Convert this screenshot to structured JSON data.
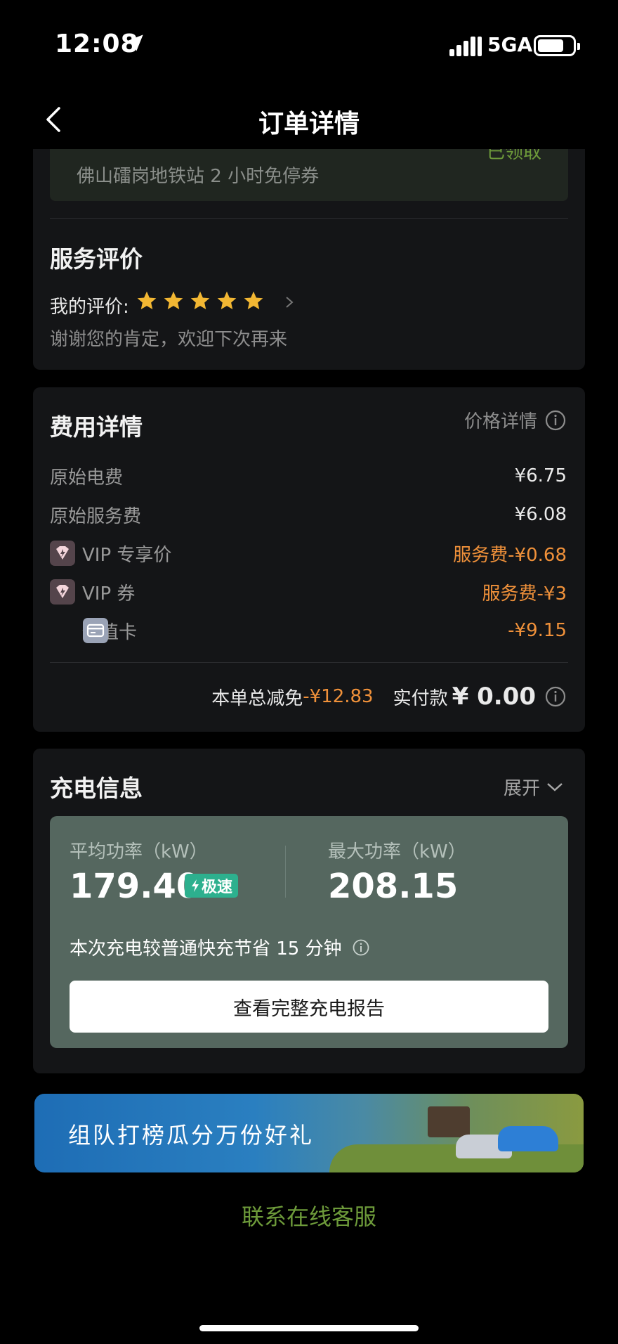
{
  "status": {
    "time": "12:08",
    "network": "5GA"
  },
  "nav": {
    "title": "订单详情"
  },
  "coupon": {
    "name": "佛山礌岗地铁站 2 小时免停券",
    "status": "已领取"
  },
  "review": {
    "title": "服务评价",
    "my_rating_label": "我的评价:",
    "stars": 5,
    "comment": "谢谢您的肯定，欢迎下次再来"
  },
  "fees": {
    "title": "费用详情",
    "price_detail_link": "价格详情",
    "rows": [
      {
        "label": "原始电费",
        "value": "¥6.75"
      },
      {
        "label": "原始服务费",
        "value": "¥6.08"
      },
      {
        "label": "VIP 专享价",
        "value": "服务费-¥0.68"
      },
      {
        "label": "VIP 券",
        "value": "服务费-¥3"
      },
      {
        "label": "储值卡",
        "value": "-¥9.15"
      }
    ],
    "total_discount_label": "本单总减免",
    "total_discount_value": "-¥12.83",
    "paid_label": "实付款",
    "paid_value": "¥ 0.00"
  },
  "charging": {
    "title": "充电信息",
    "expand_label": "展开",
    "avg_power_label": "平均功率（kW）",
    "avg_power_value": "179.40",
    "speed_badge": "极速",
    "max_power_label": "最大功率（kW）",
    "max_power_value": "208.15",
    "saving_text": "本次充电较普通快充节省 15 分钟",
    "report_button": "查看完整充电报告"
  },
  "banner": {
    "text": "组队打榜瓜分万份好礼"
  },
  "support": {
    "label": "联系在线客服"
  },
  "colors": {
    "orange": "#f0913a",
    "green": "#6d9a3a",
    "badge": "#2db08e",
    "panel": "#55675f"
  }
}
